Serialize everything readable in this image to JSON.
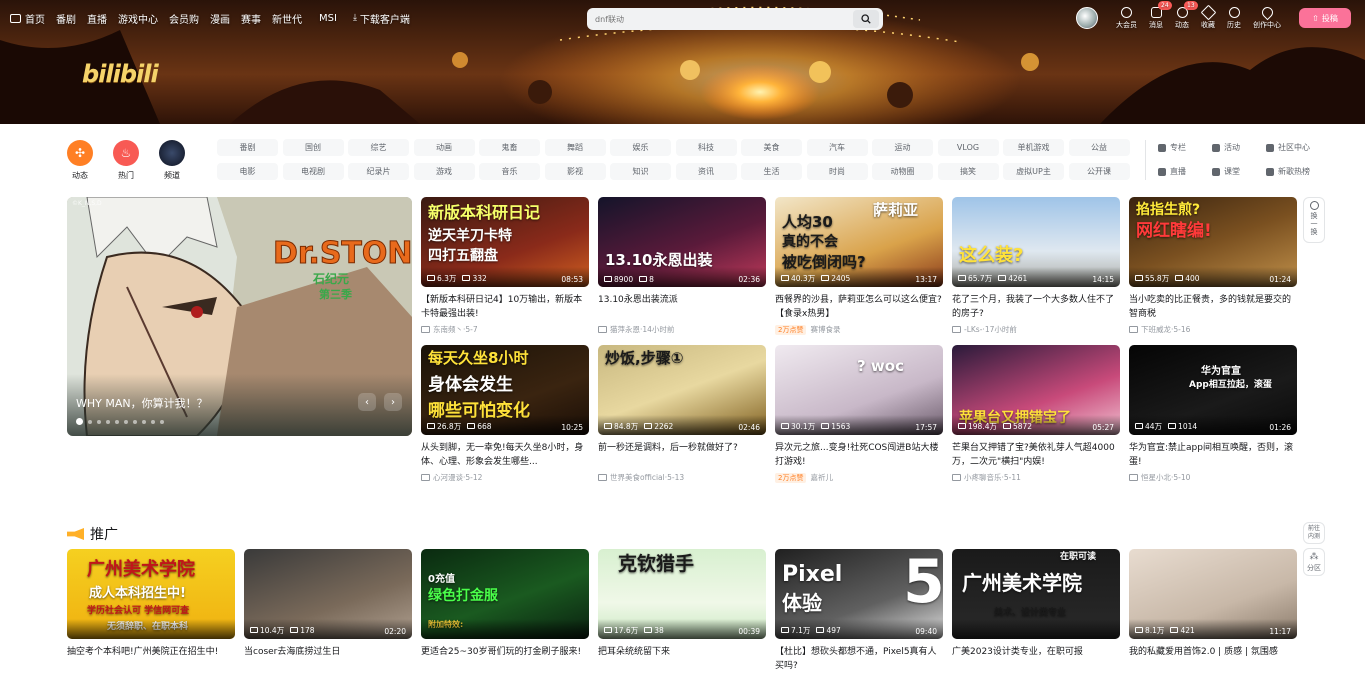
{
  "header": {
    "nav": [
      "首页",
      "番剧",
      "直播",
      "游戏中心",
      "会员购",
      "漫画",
      "赛事",
      "新世代",
      "MSI",
      "下载客户端"
    ],
    "search_placeholder": "dnf联动",
    "right_items": [
      {
        "label": "大会员",
        "badge": ""
      },
      {
        "label": "消息",
        "badge": "24"
      },
      {
        "label": "动态",
        "badge": "13"
      },
      {
        "label": "收藏",
        "badge": ""
      },
      {
        "label": "历史",
        "badge": ""
      },
      {
        "label": "创作中心",
        "badge": ""
      }
    ],
    "upload_label": "投稿",
    "logo_text": "bilibili"
  },
  "main_channels": [
    {
      "label": "动态",
      "color": "#ff7f24"
    },
    {
      "label": "热门",
      "color": "#f85a54"
    },
    {
      "label": "频道",
      "color": "#18191c"
    }
  ],
  "tags": [
    "番剧",
    "国创",
    "综艺",
    "动画",
    "鬼畜",
    "舞蹈",
    "娱乐",
    "科技",
    "美食",
    "汽车",
    "运动",
    "VLOG",
    "单机游戏",
    "公益",
    "电影",
    "电视剧",
    "纪录片",
    "游戏",
    "音乐",
    "影视",
    "知识",
    "资讯",
    "生活",
    "时尚",
    "动物圈",
    "搞笑",
    "虚拟UP主",
    "公开课"
  ],
  "extra_links": [
    "专栏",
    "活动",
    "社区中心",
    "直播",
    "课堂",
    "新歌热榜"
  ],
  "carousel": {
    "title": "WHY MAN，你算计我！？",
    "badge": "©K_N,S,D",
    "art_title": "Dr.STONE",
    "art_sub": "石纪元",
    "art_season": "第三季",
    "dots": 10,
    "active_dot": 0
  },
  "videos": [
    {
      "thumb_text": "新版本科研日记",
      "thumb_text2": "逆天羊刀卡特",
      "thumb_text3": "四打五翻盘",
      "views": "6.3万",
      "danmaku": "332",
      "duration": "08:53",
      "title": "【新版本科研日记4】10万输出，新版本卡特最强出装!",
      "author": "东南频丶",
      "date": "5-7",
      "hot": ""
    },
    {
      "thumb_text": "13.10永恩出装",
      "views": "8900",
      "danmaku": "8",
      "duration": "02:36",
      "title": "13.10永恩出装流派",
      "author": "猫萍永恩",
      "date": "14小时前",
      "hot": ""
    },
    {
      "thumb_text": "人均30",
      "thumb_text2": "真的不会",
      "thumb_text3": "被吃倒闭吗?",
      "thumb_text4": "萨莉亚",
      "views": "40.3万",
      "danmaku": "2405",
      "duration": "13:17",
      "title": "西餐界的沙县，萨莉亚怎么可以这么便宜?【食录x热男】",
      "author": "赛博食录",
      "date": "",
      "hot": "2万点赞"
    },
    {
      "thumb_text": "这么装?",
      "views": "65.7万",
      "danmaku": "4261",
      "duration": "14:15",
      "title": "花了三个月，我装了一个大多数人住不了的房子?",
      "author": "-LKs-",
      "date": "17小时前",
      "hot": ""
    },
    {
      "thumb_text": "掐指生煎?",
      "thumb_text2": "网红瞎编!",
      "views": "55.8万",
      "danmaku": "400",
      "duration": "01:24",
      "title": "当小吃卖的比正餐贵，多的钱就是要交的智商税",
      "author": "下班威龙",
      "date": "5-16",
      "hot": ""
    },
    {
      "thumb_text": "每天久坐8小时",
      "thumb_text2": "身体会发生",
      "thumb_text3": "哪些可怕变化",
      "views": "26.8万",
      "danmaku": "668",
      "duration": "10:25",
      "title": "从头到脚，无一幸免!每天久坐8小时，身体、心理、形象会发生哪些...",
      "author": "心河漫谈",
      "date": "5-12",
      "hot": ""
    },
    {
      "thumb_text": "炒饭,步骤①",
      "views": "84.8万",
      "danmaku": "2262",
      "duration": "02:46",
      "title": "前一秒还是调料，后一秒就做好了?",
      "author": "世界美食official",
      "date": "5-13",
      "hot": ""
    },
    {
      "thumb_text": "? woc",
      "views": "30.1万",
      "danmaku": "1563",
      "duration": "17:57",
      "title": "异次元之旅...变身!社死COS闯进B站大楼打游戏!",
      "author": "嘉祈儿",
      "date": "",
      "hot": "2万点赞"
    },
    {
      "thumb_text": "苹果台又押错宝了",
      "views": "198.4万",
      "danmaku": "5872",
      "duration": "05:27",
      "title": "芒果台又押错了宝?美依礼芽人气超4000万，二次元\"横扫\"内娱!",
      "author": "小疼聊音乐",
      "date": "5-11",
      "hot": ""
    },
    {
      "thumb_text": "华为官宣",
      "thumb_text2": "App相互拉起，滚蛋",
      "views": "44万",
      "danmaku": "1014",
      "duration": "01:26",
      "title": "华为官宣:禁止app间相互唤醒，否则，滚蛋!",
      "author": "恒星小北",
      "date": "5-10",
      "hot": ""
    }
  ],
  "side_buttons": {
    "refresh": "换一换",
    "goto": "前往内测",
    "zone": "分区"
  },
  "promo_section": {
    "title": "推广",
    "videos": [
      {
        "thumb_text": "广州美术学院",
        "thumb_text2": "成人本科招生中!",
        "thumb_text3": "学历社会认可 学信网可查",
        "thumb_text4": "无须辞职、在职本科",
        "views": "",
        "danmaku": "",
        "duration": "",
        "title": "抽空考个本科吧!广州美院正在招生中!"
      },
      {
        "thumb_text": "",
        "views": "10.4万",
        "danmaku": "178",
        "duration": "02:20",
        "title": "当coser去海底捞过生日"
      },
      {
        "thumb_text": "0充值",
        "thumb_text2": "绿色打金服",
        "thumb_text3": "附加特效:",
        "views": "",
        "danmaku": "",
        "duration": "",
        "title": "更适合25~30岁哥们玩的打金刷子服来!"
      },
      {
        "thumb_text": "克钦猎手",
        "views": "17.6万",
        "danmaku": "38",
        "duration": "00:39",
        "title": "把耳朵统统留下来"
      },
      {
        "thumb_text": "Pixel",
        "thumb_text2": "体验",
        "thumb_text3": "5",
        "views": "7.1万",
        "danmaku": "497",
        "duration": "09:40",
        "title": "【杜比】想砍头都想不通，Pixel5真有人买吗?"
      },
      {
        "thumb_text": "广州美术学院",
        "thumb_text2": "在职可读",
        "thumb_text3": "美术、设计类专业",
        "views": "",
        "danmaku": "",
        "duration": "",
        "title": "广美2023设计类专业，在职可报"
      },
      {
        "thumb_text": "",
        "views": "8.1万",
        "danmaku": "421",
        "duration": "11:17",
        "title": "我的私藏爱用首饰2.0 | 质感 | 氛围感"
      }
    ]
  },
  "colors": {
    "accent": "#fb7299",
    "hot": "#ff7f24",
    "text": "#18191c",
    "muted": "#9499a0"
  }
}
